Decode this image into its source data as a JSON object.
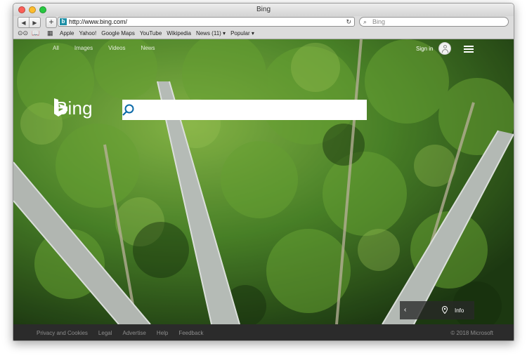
{
  "window": {
    "title": "Bing"
  },
  "toolbar": {
    "back_icon": "back-arrow-icon",
    "forward_icon": "forward-arrow-icon",
    "url": "http://www.bing.com/",
    "search_placeholder": "Bing"
  },
  "bookmarks": [
    "Apple",
    "Yahoo!",
    "Google Maps",
    "YouTube",
    "Wikipedia",
    "News (11) ▾",
    "Popular ▾"
  ],
  "bing": {
    "nav": [
      "All",
      "Images",
      "Videos",
      "News"
    ],
    "sign_in": "Sign in",
    "logo_text": "Bing",
    "search_value": "",
    "info_label": "Info",
    "footer_links": [
      "Privacy and Cookies",
      "Legal",
      "Advertise",
      "Help",
      "Feedback"
    ],
    "copyright": "© 2018 Microsoft"
  },
  "colors": {
    "brand": "#1e8fa6",
    "search_icon": "#0c6aa8",
    "footer_bg": "#2b2b2b"
  }
}
